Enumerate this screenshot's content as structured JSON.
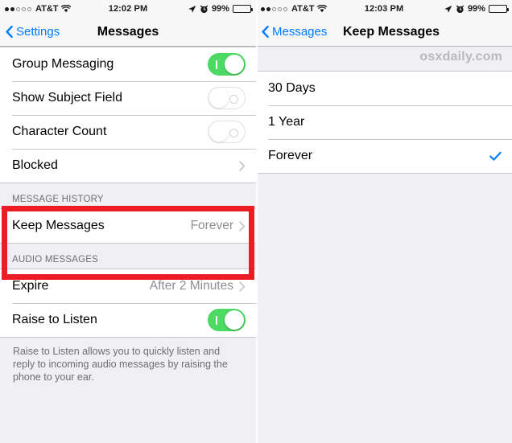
{
  "left_panel": {
    "status_bar": {
      "signal_dots_filled": 2,
      "signal_dots_total": 5,
      "carrier": "AT&T",
      "wifi_icon": "wifi-icon",
      "time": "12:02 PM",
      "location_icon": "location-arrow-icon",
      "alarm_icon": "alarm-clock-icon",
      "battery_percent": "99%",
      "battery_icon": "battery-icon"
    },
    "nav": {
      "back_label": "Settings",
      "back_icon": "chevron-left-icon",
      "title": "Messages"
    },
    "section1": {
      "rows": [
        {
          "label": "Group Messaging",
          "control": "toggle",
          "state": "on"
        },
        {
          "label": "Show Subject Field",
          "control": "toggle",
          "state": "off"
        },
        {
          "label": "Character Count",
          "control": "toggle",
          "state": "off"
        },
        {
          "label": "Blocked",
          "control": "chevron",
          "value": ""
        }
      ]
    },
    "section2": {
      "header": "MESSAGE HISTORY",
      "rows": [
        {
          "label": "Keep Messages",
          "control": "chevron",
          "value": "Forever"
        }
      ]
    },
    "section3": {
      "header": "AUDIO MESSAGES",
      "rows": [
        {
          "label": "Expire",
          "control": "chevron",
          "value": "After 2 Minutes"
        },
        {
          "label": "Raise to Listen",
          "control": "toggle",
          "state": "on"
        }
      ],
      "footer": "Raise to Listen allows you to quickly listen and reply to incoming audio messages by raising the phone to your ear."
    }
  },
  "right_panel": {
    "status_bar": {
      "signal_dots_filled": 2,
      "signal_dots_total": 5,
      "carrier": "AT&T",
      "wifi_icon": "wifi-icon",
      "time": "12:03 PM",
      "location_icon": "location-arrow-icon",
      "alarm_icon": "alarm-clock-icon",
      "battery_percent": "99%",
      "battery_icon": "battery-icon"
    },
    "nav": {
      "back_label": "Messages",
      "back_icon": "chevron-left-icon",
      "title": "Keep Messages"
    },
    "watermark": "osxdaily.com",
    "options": [
      {
        "label": "30 Days",
        "selected": false
      },
      {
        "label": "1 Year",
        "selected": false
      },
      {
        "label": "Forever",
        "selected": true
      }
    ]
  },
  "annotation": {
    "highlight_color": "#ed1c24",
    "highlight_target": "MESSAGE HISTORY / Keep Messages"
  },
  "colors": {
    "accent_blue": "#007aff",
    "toggle_on_green": "#4cd964",
    "group_bg": "#efeff4",
    "separator": "#c8c7cc",
    "secondary_text": "#8e8e93"
  }
}
